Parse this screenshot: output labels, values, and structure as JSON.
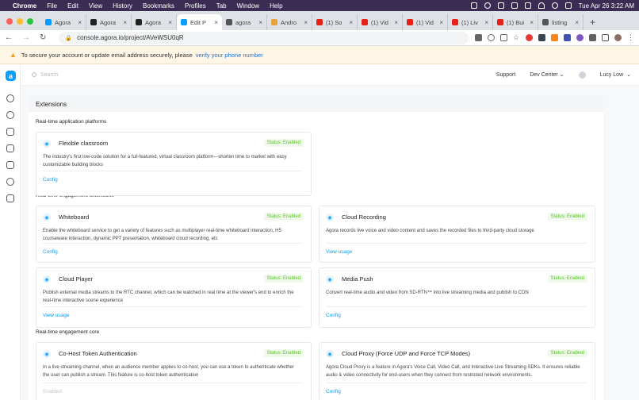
{
  "menubar": {
    "apple": "",
    "app": "Chrome",
    "items": [
      "File",
      "Edit",
      "View",
      "History",
      "Bookmarks",
      "Profiles",
      "Tab",
      "Window",
      "Help"
    ],
    "datetime": "Tue Apr 26  3:22 AM"
  },
  "tabs": [
    {
      "label": "Agora",
      "color": "#099dfd"
    },
    {
      "label": "Agora",
      "color": "#222"
    },
    {
      "label": "Agora",
      "color": "#222"
    },
    {
      "label": "Edit P",
      "color": "#099dfd",
      "active": true
    },
    {
      "label": "agora",
      "color": "#555"
    },
    {
      "label": "Andro",
      "color": "#e8a33d"
    },
    {
      "label": "(1) So",
      "color": "#e62117"
    },
    {
      "label": "(1) Vid",
      "color": "#e62117"
    },
    {
      "label": "(1) Vid",
      "color": "#e62117"
    },
    {
      "label": "(1) Liv",
      "color": "#e62117"
    },
    {
      "label": "(1) Bui",
      "color": "#e62117"
    },
    {
      "label": "listing",
      "color": "#555"
    }
  ],
  "newtab": "+",
  "address": {
    "url": "console.agora.io/project/AVeWSU0qR"
  },
  "notice": {
    "text": "To secure your account or update email address securely, please",
    "link": "verify your phone number"
  },
  "topbar": {
    "search_placeholder": "Search",
    "support": "Support",
    "dev_center": "Dev Center",
    "user": "Lucy Low"
  },
  "panel": {
    "title": "Extensions"
  },
  "sections": [
    {
      "title": "Real-time application platforms"
    },
    {
      "title": "Real-time engagement extensions"
    },
    {
      "title": "Real-time engagement core"
    }
  ],
  "cards": [
    {
      "icon": "classroom-icon",
      "title": "Flexible classroom",
      "status": "Status: Enabled",
      "desc": "The industry's first low-code solution for a full-featured, virtual classroom platform—shorten time to market with easy customizable building blocks",
      "link": "Config"
    },
    {
      "icon": "whiteboard-icon",
      "title": "Whiteboard",
      "status": "Status: Enabled",
      "desc": "Enable the whiteboard service to get a variety of features such as multiplayer real-time whiteboard interaction, H5 courseware interaction, dynamic PPT presentation, whiteboard cloud recording, etc",
      "link": "Config"
    },
    {
      "icon": "cloud-recording-icon",
      "title": "Cloud Recording",
      "status": "Status: Enabled",
      "desc": "Agora records live voice and video content and saves the recorded files to third-party cloud storage",
      "link": "View usage"
    },
    {
      "icon": "cloud-player-icon",
      "title": "Cloud Player",
      "status": "Status: Enabled",
      "desc": "Publish external media streams to the RTC channel, which can be watched in real time at the viewer's end to enrich the real-time interactive scene experience",
      "link": "View usage"
    },
    {
      "icon": "media-push-icon",
      "title": "Media Push",
      "status": "Status: Enabled",
      "desc": "Convert real-time audio and video from SD-RTN™ into live streaming media and publish to CDN",
      "link": "Config"
    },
    {
      "icon": "token-icon",
      "title": "Co-Host Token Authentication",
      "status": "Status: Enabled",
      "desc": "In a live streaming channel, when an audience member applies to co-host, you can use a token to authenticate whether the user can publish a stream. This feature is co-host token authentication",
      "link": "Enabled"
    },
    {
      "icon": "cloud-proxy-icon",
      "title": "Cloud Proxy (Force UDP and Force TCP Modes)",
      "status": "Status: Enabled",
      "desc": "Agora Cloud Proxy is a feature in Agora's Voice Call, Video Call, and Interactive Live Streaming SDKs. It ensures reliable audio & video connectivity for end-users when they connect from restricted network environments.",
      "link": "Config"
    }
  ],
  "colors": {
    "accent": "#099dfd",
    "enabled": "#52c41a"
  }
}
